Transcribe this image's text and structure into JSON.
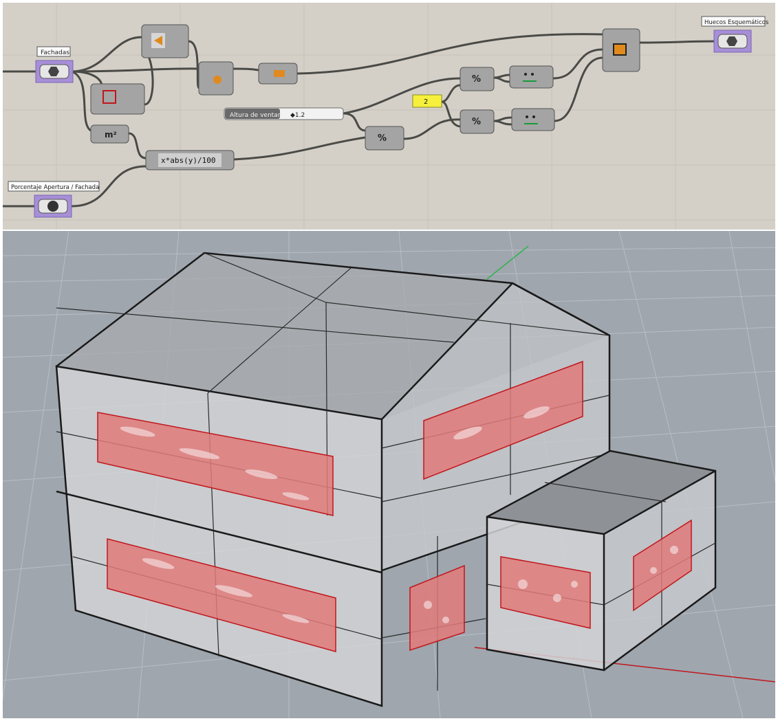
{
  "canvas": {
    "params": {
      "fachadas": "Fachadas",
      "porcentaje": "Porcentaje Apertura / Fachada",
      "huecos": "Huecos Esquemáticos"
    },
    "slider": {
      "label": "Altura de ventana",
      "value": "◆1.2"
    },
    "panel_value": "2",
    "expression": "x*abs(y)/100",
    "param_icon": "hexagon-geometry-icon",
    "number_icon": "0.1"
  },
  "colors": {
    "canvas_bg": "#d4d0c8",
    "param_selected": "#a78fd8",
    "component": "#a4a4a4",
    "wire": "#4a4a46",
    "viewport_bg": "#9fa6ae",
    "window_fill": "#e07a7a",
    "window_edge": "#c0161b",
    "panel_yellow": "#f6f03c"
  }
}
